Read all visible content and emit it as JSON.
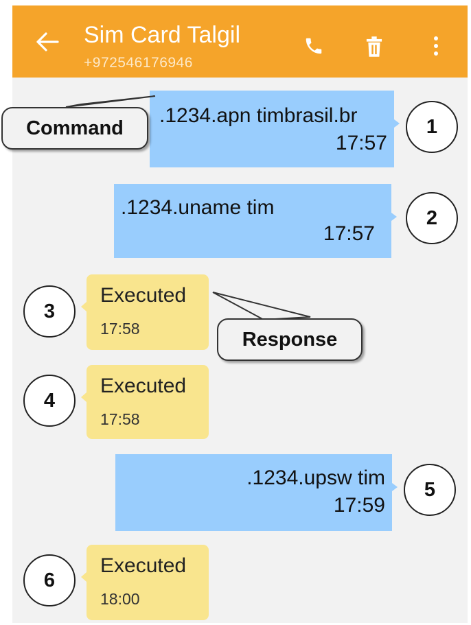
{
  "header": {
    "title": "Sim Card Talgil",
    "subtitle": "+972546176946",
    "back_icon": "arrow-left-icon",
    "actions": [
      "phone-icon",
      "trash-icon",
      "more-vertical-icon"
    ],
    "color": "#f5a42a"
  },
  "messages": [
    {
      "direction": "out",
      "text": ".1234.apn timbrasil.br",
      "time": "17:57",
      "marker": "1"
    },
    {
      "direction": "out",
      "text": ".1234.uname tim",
      "time": "17:57",
      "marker": "2"
    },
    {
      "direction": "in",
      "text": "Executed",
      "time": "17:58",
      "marker": "3"
    },
    {
      "direction": "in",
      "text": "Executed",
      "time": "17:58",
      "marker": "4"
    },
    {
      "direction": "out",
      "text": ".1234.upsw tim",
      "time": "17:59",
      "marker": "5"
    },
    {
      "direction": "in",
      "text": "Executed",
      "time": "18:00",
      "marker": "6"
    }
  ],
  "callouts": {
    "command": "Command",
    "response": "Response"
  },
  "colors": {
    "outgoing_bubble": "#99cdfd",
    "incoming_bubble": "#f9e58e",
    "background": "#f2f2f2"
  }
}
